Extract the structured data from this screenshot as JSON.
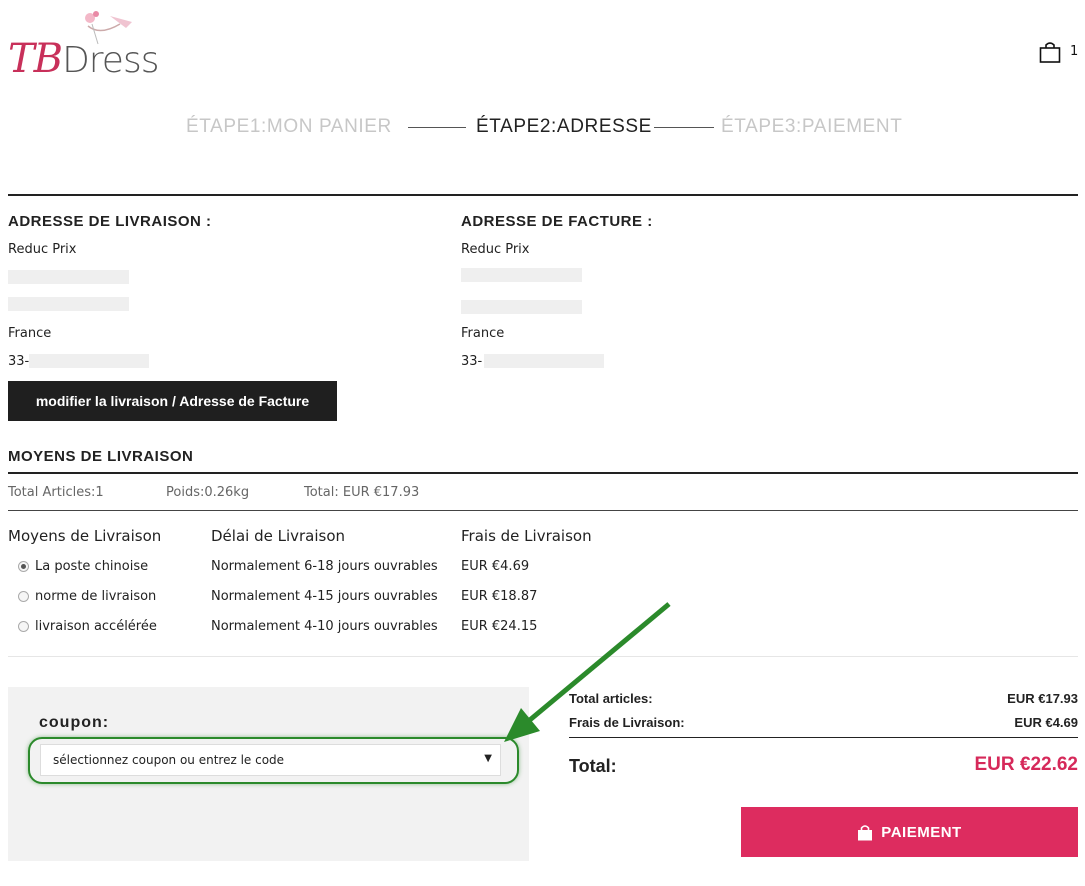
{
  "brand": {
    "logo_tb": "TB",
    "logo_dress": "Dress"
  },
  "header": {
    "cart_count": "1"
  },
  "steps": [
    {
      "label": "ÉTAPE1:MON PANIER",
      "state": "done"
    },
    {
      "label": "ÉTAPE2:ADRESSE",
      "state": "current"
    },
    {
      "label": "ÉTAPE3:PAIEMENT",
      "state": "todo"
    }
  ],
  "shipping_address": {
    "title": "ADRESSE DE LIVRAISON :",
    "name": "Reduc Prix",
    "country": "France",
    "phone": "33-"
  },
  "billing_address": {
    "title": "ADRESSE DE FACTURE :",
    "name": "Reduc Prix",
    "country": "France",
    "phone": "33-"
  },
  "edit_button": "modifier la livraison / Adresse de Facture",
  "delivery": {
    "title": "MOYENS DE LIVRAISON",
    "summary": {
      "articles": "Total Articles:1",
      "weight": "Poids:0.26kg",
      "total": "Total: EUR €17.93"
    },
    "headers": {
      "method": "Moyens de Livraison",
      "delay": "Délai de Livraison",
      "fee": "Frais de Livraison"
    },
    "options": [
      {
        "method": "La poste chinoise",
        "delay": "Normalement 6-18 jours ouvrables",
        "fee": "EUR €4.69",
        "selected": true
      },
      {
        "method": "norme de livraison",
        "delay": "Normalement 4-15 jours ouvrables",
        "fee": "EUR €18.87",
        "selected": false
      },
      {
        "method": "livraison accélérée",
        "delay": "Normalement 4-10 jours ouvrables",
        "fee": "EUR €24.15",
        "selected": false
      }
    ]
  },
  "coupon": {
    "label": "coupon:",
    "placeholder": "sélectionnez coupon ou entrez le code"
  },
  "totals": {
    "articles_label": "Total articles:",
    "articles_value": "EUR €17.93",
    "shipping_label": "Frais de Livraison:",
    "shipping_value": "EUR €4.69",
    "grand_label": "Total:",
    "grand_value": "EUR €22.62"
  },
  "pay_button": "PAIEMENT",
  "colors": {
    "accent": "#dd2c5f",
    "annotation": "#2b8a2b",
    "dark_button": "#1f1f1f"
  },
  "icons": [
    "logo-flower-icon",
    "shopping-bag-icon",
    "radio-icon",
    "dropdown-caret-icon",
    "lock-bag-icon",
    "annotation-arrow-icon"
  ]
}
